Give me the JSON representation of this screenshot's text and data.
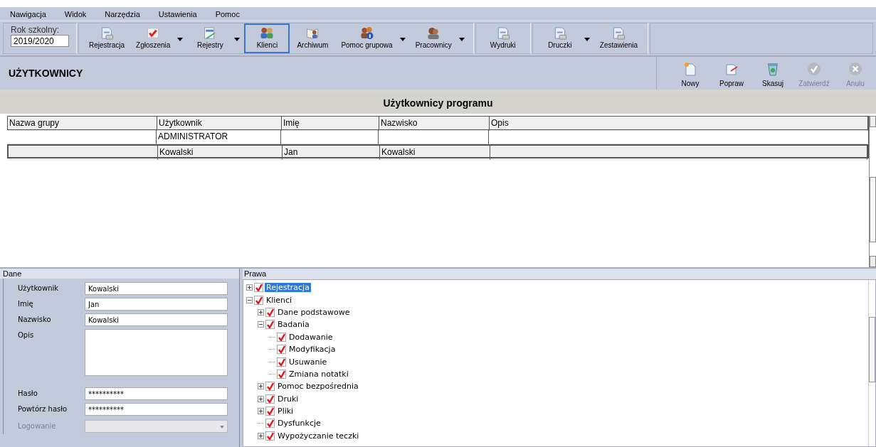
{
  "menu": [
    "Nawigacja",
    "Widok",
    "Narzędzia",
    "Ustawienia",
    "Pomoc"
  ],
  "school_year": {
    "label": "Rok szkolny:",
    "value": "2019/2020"
  },
  "toolbar_groups": [
    {
      "buttons": [
        {
          "label": "Rejestracja",
          "dropdown": false,
          "selected": false
        },
        {
          "label": "Zgłoszenia",
          "dropdown": true,
          "selected": false
        },
        {
          "label": "Rejestry",
          "dropdown": true,
          "selected": false
        },
        {
          "label": "Klienci",
          "dropdown": false,
          "selected": true
        },
        {
          "label": "Archiwum",
          "dropdown": false,
          "selected": false
        },
        {
          "label": "Pomoc grupowa",
          "dropdown": true,
          "selected": false
        },
        {
          "label": "Pracownicy",
          "dropdown": true,
          "selected": false
        }
      ]
    },
    {
      "buttons": [
        {
          "label": "Wydruki",
          "dropdown": false,
          "selected": false
        }
      ]
    },
    {
      "buttons": [
        {
          "label": "Druczki",
          "dropdown": true,
          "selected": false
        },
        {
          "label": "Zestawienia",
          "dropdown": false,
          "selected": false
        }
      ]
    }
  ],
  "section": {
    "title": "UŻYTKOWNICY",
    "actions": [
      {
        "label": "Nowy",
        "disabled": false
      },
      {
        "label": "Popraw",
        "disabled": false
      },
      {
        "label": "Skasuj",
        "disabled": false
      },
      {
        "label": "Zatwierdź",
        "disabled": true
      },
      {
        "label": "Anulu",
        "disabled": true
      }
    ]
  },
  "table": {
    "title": "Użytkownicy programu",
    "columns": [
      "Nazwa grupy",
      "Użytkownik",
      "Imię",
      "Nazwisko",
      "Opis"
    ],
    "rows": [
      {
        "cells": [
          "",
          "ADMINISTRATOR",
          "",
          "",
          ""
        ],
        "selected": false
      },
      {
        "cells": [
          "",
          "Kowalski",
          "Jan",
          "Kowalski",
          ""
        ],
        "selected": true
      }
    ]
  },
  "details": {
    "title": "Dane",
    "fields": [
      {
        "label": "Użytkownik",
        "value": "Kowalski",
        "kind": "text",
        "disabled": false
      },
      {
        "label": "Imię",
        "value": "Jan",
        "kind": "text",
        "disabled": false
      },
      {
        "label": "Nazwisko",
        "value": "Kowalski",
        "kind": "text",
        "disabled": false
      },
      {
        "label": "Opis",
        "kind": "textarea",
        "disabled": false
      },
      {
        "label": "Hasło",
        "value": "**********",
        "kind": "text",
        "disabled": false
      },
      {
        "label": "Powtórz hasło",
        "value": "**********",
        "kind": "text",
        "disabled": false
      },
      {
        "label": "Logowanie",
        "kind": "combo",
        "disabled": true
      }
    ]
  },
  "rights": {
    "title": "Prawa",
    "tree": [
      {
        "label": "Rejestracja",
        "checked": true,
        "expanded": false,
        "selected": true
      },
      {
        "label": "Klienci",
        "checked": true,
        "expanded": true,
        "selected": false,
        "children": [
          {
            "label": "Dane podstawowe",
            "checked": true,
            "expanded": false,
            "selected": false
          },
          {
            "label": "Badania",
            "checked": true,
            "expanded": true,
            "selected": false,
            "children": [
              {
                "label": "Dodawanie",
                "checked": true,
                "selected": false
              },
              {
                "label": "Modyfikacja",
                "checked": true,
                "selected": false
              },
              {
                "label": "Usuwanie",
                "checked": true,
                "selected": false
              },
              {
                "label": "Zmiana notatki",
                "checked": true,
                "selected": false
              }
            ]
          },
          {
            "label": "Pomoc bezpośrednia",
            "checked": true,
            "expanded": false,
            "selected": false
          },
          {
            "label": "Druki",
            "checked": true,
            "expanded": false,
            "selected": false
          },
          {
            "label": "Pliki",
            "checked": true,
            "expanded": false,
            "selected": false
          },
          {
            "label": "Dysfunkcje",
            "checked": true,
            "selected": false
          },
          {
            "label": "Wypożyczanie teczki",
            "checked": true,
            "expanded": false,
            "selected": false
          }
        ]
      }
    ]
  }
}
